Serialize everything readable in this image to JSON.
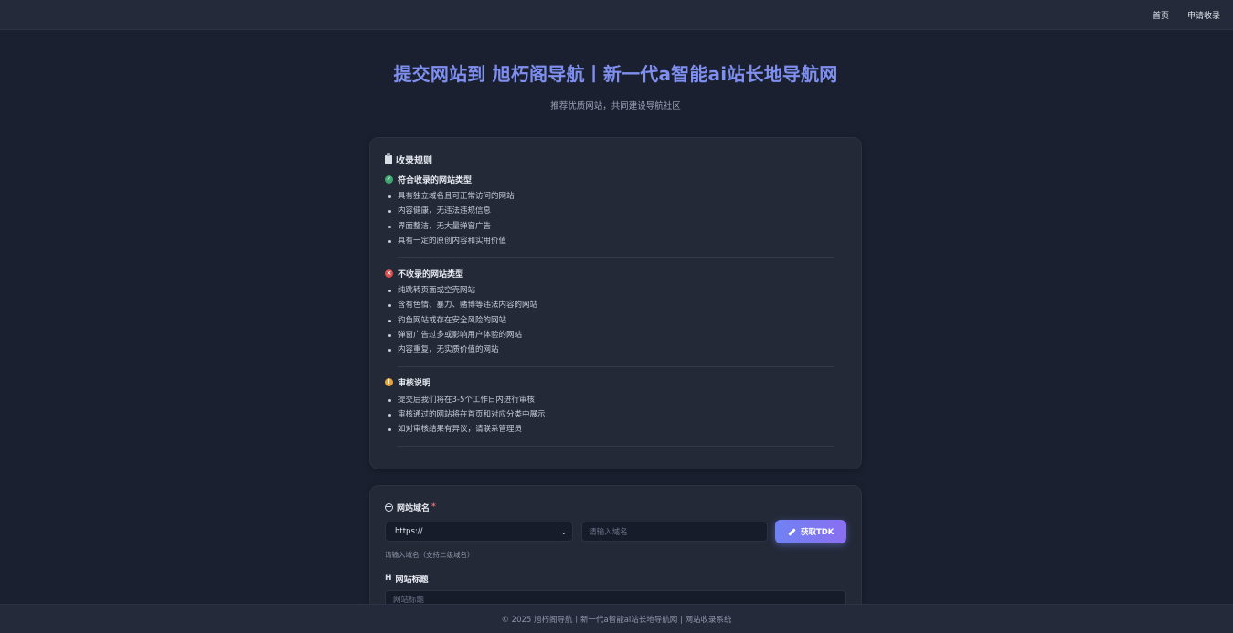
{
  "nav": {
    "home": "首页",
    "apply": "申请收录"
  },
  "hero": {
    "title": "提交网站到 旭朽阁导航丨新一代a智能ai站长地导航网",
    "subtitle": "推荐优质网站，共同建设导航社区"
  },
  "rules": {
    "title": "收录规则",
    "accepted": {
      "heading": "符合收录的网站类型",
      "items": [
        "具有独立域名且可正常访问的网站",
        "内容健康，无违法违规信息",
        "界面整洁，无大量弹窗广告",
        "具有一定的原创内容和实用价值"
      ]
    },
    "rejected": {
      "heading": "不收录的网站类型",
      "items": [
        "纯跳转页面或空壳网站",
        "含有色情、暴力、赌博等违法内容的网站",
        "钓鱼网站或存在安全风险的网站",
        "弹窗广告过多或影响用户体验的网站",
        "内容重复，无实质价值的网站"
      ]
    },
    "review": {
      "heading": "审核说明",
      "items": [
        "提交后我们将在3-5个工作日内进行审核",
        "审核通过的网站将在首页和对应分类中展示",
        "如对审核结果有异议，请联系管理员"
      ]
    }
  },
  "form": {
    "domain_label": "网站域名",
    "required_mark": "*",
    "protocol_value": "https://",
    "domain_placeholder": "请输入域名",
    "fetch_button": "获取TDK",
    "domain_hint": "请输入域名（支持二级域名）",
    "title_label": "网站标题",
    "title_placeholder": "网站标题"
  },
  "footer": {
    "text": "© 2025 旭朽阁导航丨新一代a智能ai站长地导航网 | 网站收录系统"
  },
  "colors": {
    "accent": "#7f8ff0",
    "ok": "#3fa770",
    "error": "#d94d4d",
    "warning": "#e6a23c"
  },
  "icons": {
    "rules": "clipboard-icon",
    "accepted": "check-circle-icon",
    "rejected": "x-circle-icon",
    "review": "info-circle-icon",
    "domain": "globe-icon",
    "fetch": "pencil-icon",
    "title": "heading-icon"
  }
}
